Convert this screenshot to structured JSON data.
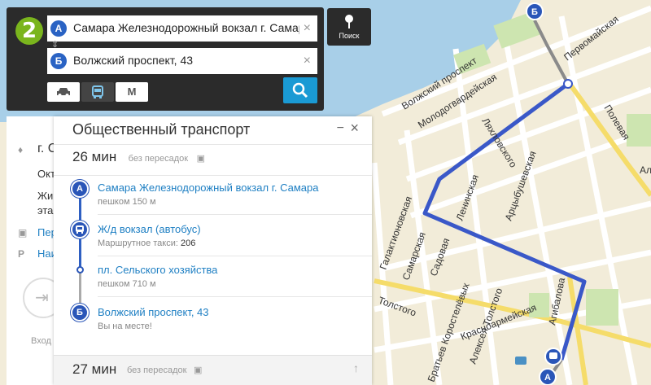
{
  "search": {
    "from": {
      "badge": "А",
      "value": "Самара Железнодорожный вокзал г. Самара",
      "clear": "×"
    },
    "to": {
      "badge": "Б",
      "value": "Волжский проспект, 43",
      "clear": "×"
    },
    "swap": "⇕",
    "modes": [
      {
        "name": "car",
        "icon": "car-icon",
        "glyph": "🚗"
      },
      {
        "name": "bus",
        "icon": "bus-icon",
        "glyph": "🚌"
      },
      {
        "name": "metro",
        "icon": "metro-icon",
        "glyph": "М"
      }
    ],
    "active_mode": "bus"
  },
  "logo": {
    "text": "2"
  },
  "poisk": {
    "label": "Поиск"
  },
  "left_card": {
    "title": "г. С",
    "lines": [
      "Окт",
      "Жи",
      "эта"
    ],
    "links": [
      "Пер",
      "Наи"
    ],
    "link_icons": [
      "bus-icon",
      "parking-icon"
    ],
    "entry_label": "Вход"
  },
  "transport": {
    "title": "Общественный транспорт",
    "minimize": "−",
    "close": "×",
    "route": {
      "duration": "26 мин",
      "transfers": "без пересадок",
      "steps": [
        {
          "badge": "А",
          "name": "Самара Железнодорожный вокзал г. Самара",
          "sub": "пешком 150 м"
        },
        {
          "badge": "bus",
          "name": "Ж/д вокзал (автобус)",
          "sub_label": "Маршрутное такси:",
          "sub_value": "206"
        },
        {
          "badge": "dot",
          "name": "пл. Сельского хозяйства",
          "sub": "пешком 710 м"
        },
        {
          "badge": "Б",
          "name": "Волжский проспект, 43",
          "sub": "Вы на месте!"
        }
      ]
    },
    "alt_route": {
      "duration": "27 мин",
      "transfers": "без пересадок",
      "arrow": "↑"
    }
  },
  "map": {
    "streets": [
      "Волжский проспект",
      "Молодогвардейская",
      "Первомайская",
      "Полевая",
      "Ляхловского",
      "Ленинская",
      "Арцыбушевская",
      "Галактионовская",
      "Самарская",
      "Садовая",
      "Красноармейская",
      "Агибалова",
      "Толстого",
      "Братьев Коростелёвых",
      "Алексея Толстого",
      "Ал"
    ],
    "markers": {
      "end": "Б",
      "start": "А"
    },
    "colors": {
      "water": "#a8cfe8",
      "land": "#f2ecd9",
      "park": "#cde5b0",
      "road": "#ffffff",
      "main_road": "#f5dc6a",
      "route": "#3a58c8"
    }
  }
}
